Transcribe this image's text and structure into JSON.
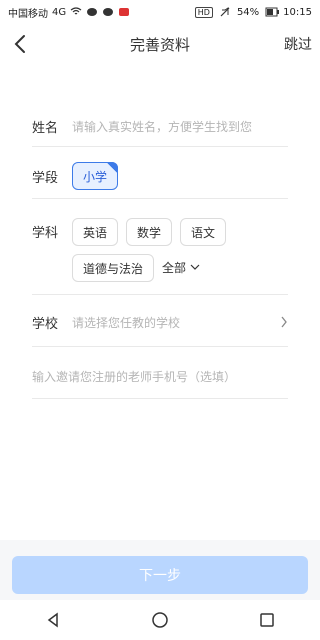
{
  "statusbar": {
    "carrier": "中国移动",
    "signal": "4G",
    "battery": "54%",
    "time": "10:15",
    "hd": "HD"
  },
  "header": {
    "title": "完善资料",
    "skip_label": "跳过"
  },
  "form": {
    "name": {
      "label": "姓名",
      "placeholder": "请输入真实姓名，方便学生找到您"
    },
    "stage": {
      "label": "学段",
      "options": [
        "小学"
      ],
      "selected": "小学"
    },
    "subject": {
      "label": "学科",
      "options": [
        "英语",
        "数学",
        "语文",
        "道德与法治"
      ],
      "all_label": "全部"
    },
    "school": {
      "label": "学校",
      "placeholder": "请选择您任教的学校"
    },
    "invite": {
      "placeholder": "输入邀请您注册的老师手机号（选填）"
    }
  },
  "footer": {
    "next_label": "下一步"
  },
  "colors": {
    "accent": "#3d7be8",
    "button_disabled": "#b9d6ff"
  }
}
